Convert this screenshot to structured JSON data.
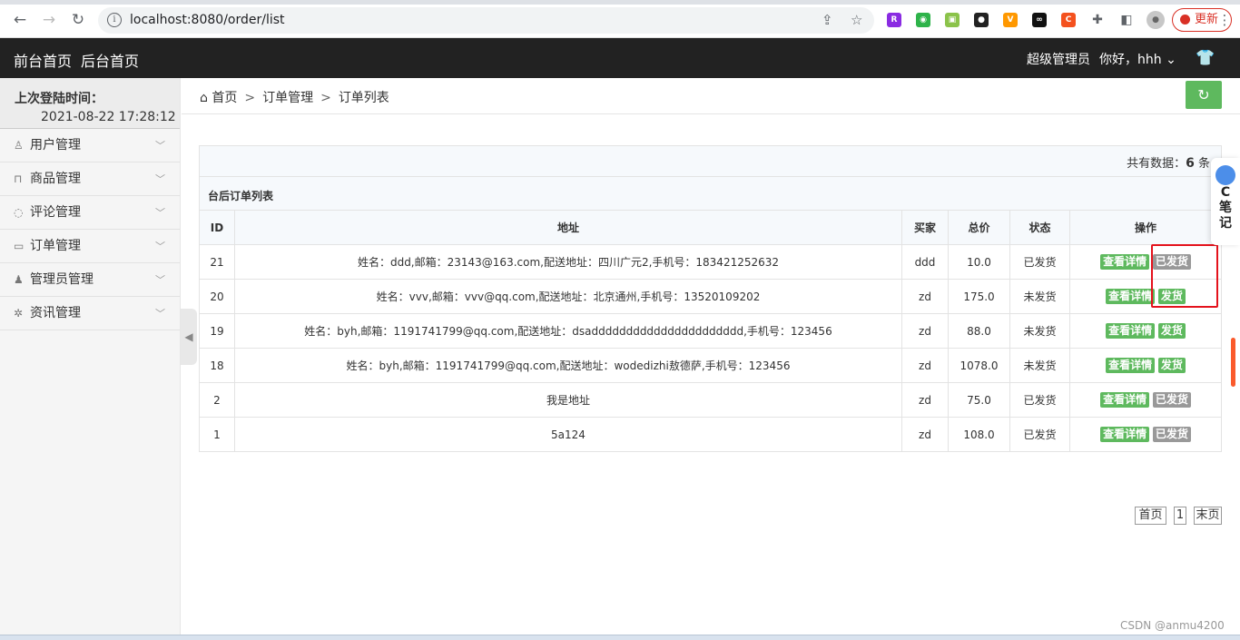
{
  "browser": {
    "url": "localhost:8080/order/list",
    "update_label": "更新"
  },
  "header": {
    "front_home": "前台首页",
    "back_home": "后台首页",
    "role": "超级管理员",
    "greeting": "你好，hhh"
  },
  "sidebar": {
    "last_login_label": "上次登陆时间：",
    "last_login_value": "2021-08-22 17:28:12",
    "items": [
      {
        "label": "用户管理",
        "icon": "user-icon"
      },
      {
        "label": "商品管理",
        "icon": "bag-icon"
      },
      {
        "label": "评论管理",
        "icon": "comment-icon"
      },
      {
        "label": "订单管理",
        "icon": "order-icon"
      },
      {
        "label": "管理员管理",
        "icon": "admin-icon"
      },
      {
        "label": "资讯管理",
        "icon": "gear-icon"
      }
    ]
  },
  "breadcrumb": {
    "home": "首页",
    "level2": "订单管理",
    "level3": "订单列表"
  },
  "summary": {
    "label": "共有数据：",
    "count": "6",
    "unit": "条"
  },
  "table": {
    "title": "台后订单列表",
    "headers": [
      "ID",
      "地址",
      "买家",
      "总价",
      "状态",
      "操作"
    ],
    "detail_label": "查看详情",
    "rows": [
      {
        "id": "21",
        "address": "姓名：ddd,邮箱：23143@163.com,配送地址：四川广元2,手机号：183421252632",
        "buyer": "ddd",
        "price": "10.0",
        "status": "已发货",
        "action": "已发货"
      },
      {
        "id": "20",
        "address": "姓名：vvv,邮箱：vvv@qq.com,配送地址：北京通州,手机号：13520109202",
        "buyer": "zd",
        "price": "175.0",
        "status": "未发货",
        "action": "发货"
      },
      {
        "id": "19",
        "address": "姓名：byh,邮箱：1191741799@qq.com,配送地址：dsadddddddddddddddddddddd,手机号：123456",
        "buyer": "zd",
        "price": "88.0",
        "status": "未发货",
        "action": "发货"
      },
      {
        "id": "18",
        "address": "姓名：byh,邮箱：1191741799@qq.com,配送地址：wodedizhi敖德萨,手机号：123456",
        "buyer": "zd",
        "price": "1078.0",
        "status": "未发货",
        "action": "发货"
      },
      {
        "id": "2",
        "address": "我是地址",
        "buyer": "zd",
        "price": "75.0",
        "status": "已发货",
        "action": "已发货"
      },
      {
        "id": "1",
        "address": "5a124",
        "buyer": "zd",
        "price": "108.0",
        "status": "已发货",
        "action": "已发货"
      }
    ]
  },
  "pager": {
    "first": "首页",
    "page": "1",
    "last": "末页"
  },
  "float_note": {
    "c": "C",
    "l1": "笔",
    "l2": "记"
  },
  "watermark": "CSDN @anmu4200",
  "colors": {
    "header_bg": "#222222",
    "green": "#5eb95e",
    "grey_button": "#999999",
    "highlight_red": "#e4121c"
  }
}
